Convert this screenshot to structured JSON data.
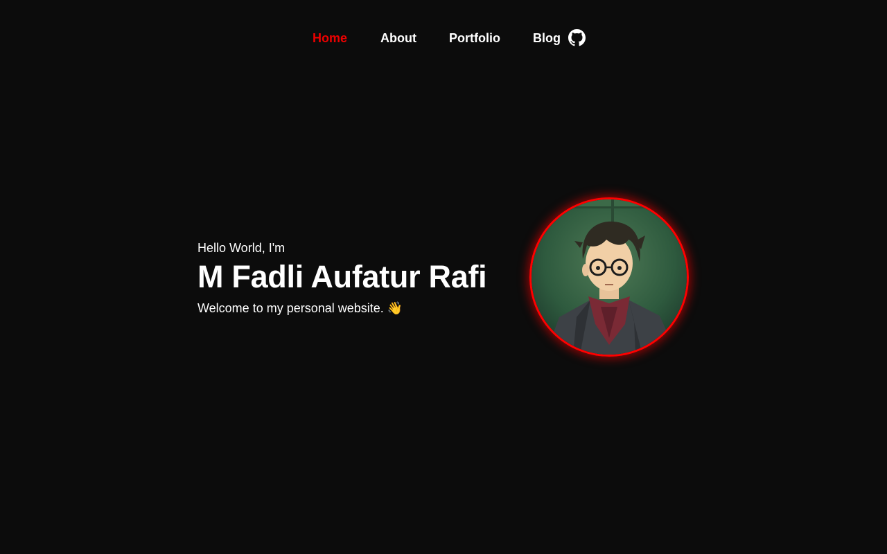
{
  "nav": {
    "items": [
      {
        "label": "Home",
        "active": true
      },
      {
        "label": "About",
        "active": false
      },
      {
        "label": "Portfolio",
        "active": false
      },
      {
        "label": "Blog",
        "active": false
      }
    ],
    "github_icon": "github-icon"
  },
  "hero": {
    "greeting": "Hello World, I'm",
    "name": "M Fadli Aufatur Rafi",
    "welcome": "Welcome to my personal website. 👋"
  },
  "avatar": {
    "icon": "avatar-portrait",
    "ring_color": "#ff0000"
  },
  "colors": {
    "background": "#0c0c0c",
    "accent": "#ee0000",
    "text": "#ffffff"
  }
}
